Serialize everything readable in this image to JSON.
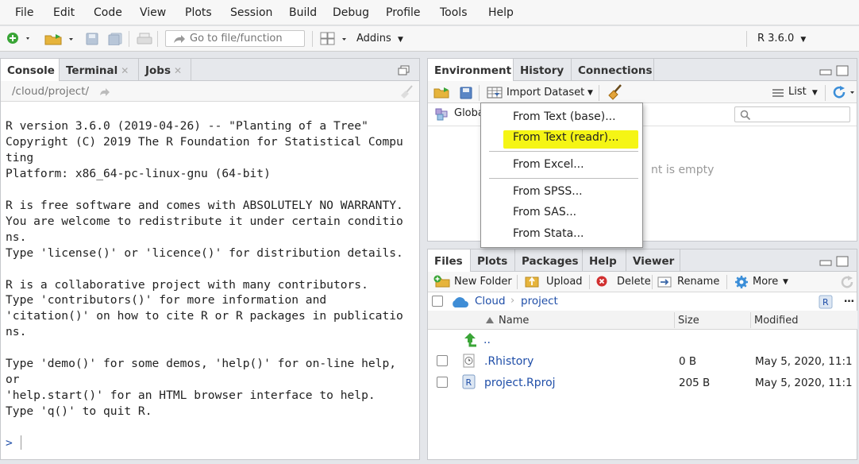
{
  "menubar": {
    "items": [
      "File",
      "Edit",
      "Code",
      "View",
      "Plots",
      "Session",
      "Build",
      "Debug",
      "Profile",
      "Tools",
      "Help"
    ]
  },
  "toolbar": {
    "goto_placeholder": "Go to file/function",
    "addins_label": "Addins",
    "r_version_label": "R 3.6.0"
  },
  "left_pane": {
    "tabs": [
      {
        "label": "Console",
        "closable": false,
        "active": true
      },
      {
        "label": "Terminal",
        "closable": true,
        "active": false
      },
      {
        "label": "Jobs",
        "closable": true,
        "active": false
      }
    ],
    "path": "/cloud/project/",
    "console_lines": [
      "R version 3.6.0 (2019-04-26) -- \"Planting of a Tree\"",
      "Copyright (C) 2019 The R Foundation for Statistical Compu",
      "ting",
      "Platform: x86_64-pc-linux-gnu (64-bit)",
      "",
      "R is free software and comes with ABSOLUTELY NO WARRANTY.",
      "You are welcome to redistribute it under certain conditio",
      "ns.",
      "Type 'license()' or 'licence()' for distribution details.",
      "",
      "R is a collaborative project with many contributors.",
      "Type 'contributors()' for more information and",
      "'citation()' on how to cite R or R packages in publicatio",
      "ns.",
      "",
      "Type 'demo()' for some demos, 'help()' for on-line help,",
      "or",
      "'help.start()' for an HTML browser interface to help.",
      "Type 'q()' to quit R."
    ],
    "prompt": ">"
  },
  "env_pane": {
    "tabs": [
      {
        "label": "Environment",
        "active": true
      },
      {
        "label": "History",
        "active": false
      },
      {
        "label": "Connections",
        "active": false
      }
    ],
    "import_label": "Import Dataset",
    "list_label": "List",
    "global_env_label": "Globa",
    "empty_text": "nt is empty"
  },
  "import_menu": {
    "items": [
      {
        "label": "From Text (base)...",
        "highlighted": false
      },
      {
        "label": "From Text (readr)...",
        "highlighted": true
      },
      {
        "label": "From Excel...",
        "highlighted": false
      },
      {
        "label": "From SPSS...",
        "highlighted": false
      },
      {
        "label": "From SAS...",
        "highlighted": false
      },
      {
        "label": "From Stata...",
        "highlighted": false
      }
    ],
    "highlight_color": "#f5f515"
  },
  "files_pane": {
    "tabs": [
      {
        "label": "Files",
        "active": true
      },
      {
        "label": "Plots",
        "active": false
      },
      {
        "label": "Packages",
        "active": false
      },
      {
        "label": "Help",
        "active": false
      },
      {
        "label": "Viewer",
        "active": false
      }
    ],
    "toolbar": {
      "new_folder": "New Folder",
      "upload": "Upload",
      "delete": "Delete",
      "rename": "Rename",
      "more": "More"
    },
    "breadcrumb": [
      "Cloud",
      "project"
    ],
    "columns": {
      "name": "Name",
      "size": "Size",
      "modified": "Modified"
    },
    "parent_dir": "..",
    "files": [
      {
        "name": ".Rhistory",
        "size": "0 B",
        "modified": "May 5, 2020, 11:1",
        "icon": "history-file-icon"
      },
      {
        "name": "project.Rproj",
        "size": "205 B",
        "modified": "May 5, 2020, 11:1",
        "icon": "rproj-file-icon"
      }
    ]
  },
  "colors": {
    "accent_blue": "#1f4ea8",
    "green_add": "#3aa537",
    "delete_red": "#d13030"
  }
}
